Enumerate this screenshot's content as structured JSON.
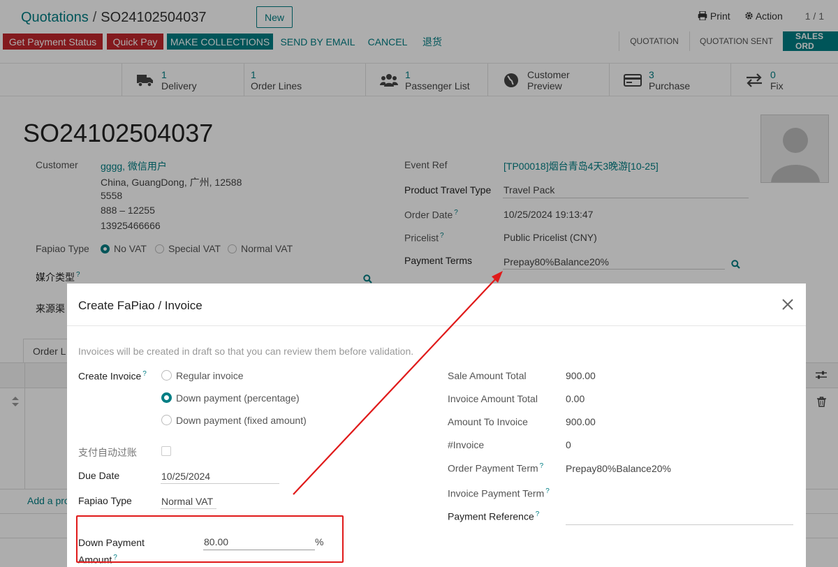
{
  "breadcrumb": {
    "parent": "Quotations",
    "current": "SO24102504037"
  },
  "header": {
    "new_label": "New",
    "print_label": "Print",
    "action_label": "Action",
    "pager": "1 / 1"
  },
  "actions": {
    "get_payment_status": "Get Payment Status",
    "quick_pay": "Quick Pay",
    "make_collections": "MAKE COLLECTIONS",
    "send_by_email": "SEND BY EMAIL",
    "cancel": "CANCEL",
    "return": "退货"
  },
  "status_stages": [
    "QUOTATION",
    "QUOTATION SENT",
    "SALES ORD"
  ],
  "smart_buttons": [
    {
      "number": "1",
      "label": "Delivery",
      "icon": "truck-icon"
    },
    {
      "number": "1",
      "label": "Order Lines",
      "icon": ""
    },
    {
      "number": "1",
      "label": "Passenger List",
      "icon": "users-icon"
    },
    {
      "number": "Customer",
      "label": "Preview",
      "icon": "globe-icon"
    },
    {
      "number": "3",
      "label": "Purchase",
      "icon": "credit-card-icon"
    },
    {
      "number": "0",
      "label": "Fix",
      "icon": "exchange-arrows-icon"
    }
  ],
  "form": {
    "title": "SO24102504037",
    "customer_label": "Customer",
    "customer_name": "gggg, 微信用户",
    "customer_address": [
      "China, GuangDong, 广州, 12588",
      "5558",
      "888 – 12255",
      "13925466666"
    ],
    "fapiao_type_label": "Fapiao Type",
    "fapiao_options": [
      "No VAT",
      "Special VAT",
      "Normal VAT"
    ],
    "media_type_label": "媒介类型",
    "source_label": "来源渠",
    "event_ref_label": "Event Ref",
    "event_ref_value": "[TP00018]烟台青岛4天3晚游[10-25]",
    "product_travel_type_label": "Product Travel Type",
    "product_travel_type_value": "Travel Pack",
    "order_date_label": "Order Date",
    "order_date_value": "10/25/2024 19:13:47",
    "pricelist_label": "Pricelist",
    "pricelist_value": "Public Pricelist (CNY)",
    "payment_terms_label": "Payment Terms",
    "payment_terms_value": "Prepay80%Balance20%",
    "order_tab_label": "Order L",
    "add_line_label": "Add a pro"
  },
  "dialog": {
    "title": "Create FaPiao / Invoice",
    "note": "Invoices will be created in draft so that you can review them before validation.",
    "create_invoice_label": "Create Invoice",
    "invoice_options": [
      "Regular invoice",
      "Down payment (percentage)",
      "Down payment (fixed amount)"
    ],
    "selected_option_index": 1,
    "auto_post_label": "支付自动过账",
    "due_date_label": "Due Date",
    "due_date_value": "10/25/2024",
    "fapiao_type_label": "Fapiao Type",
    "fapiao_type_value": "Normal VAT",
    "down_payment_label_1": "Down Payment",
    "down_payment_label_2": "Amount",
    "down_payment_value": "80.00",
    "percent_sign": "%",
    "sale_amount_total_label": "Sale Amount Total",
    "sale_amount_total_value": "900.00",
    "invoice_amount_total_label": "Invoice Amount Total",
    "invoice_amount_total_value": "0.00",
    "amount_to_invoice_label": "Amount To Invoice",
    "amount_to_invoice_value": "900.00",
    "invoice_count_label": "#Invoice",
    "invoice_count_value": "0",
    "order_payment_term_label": "Order Payment Term",
    "order_payment_term_value": "Prepay80%Balance20%",
    "invoice_payment_term_label": "Invoice Payment Term",
    "payment_reference_label": "Payment Reference"
  },
  "colors": {
    "accent": "#017e84",
    "danger": "#c1272d",
    "annotation": "#e01a1a"
  }
}
